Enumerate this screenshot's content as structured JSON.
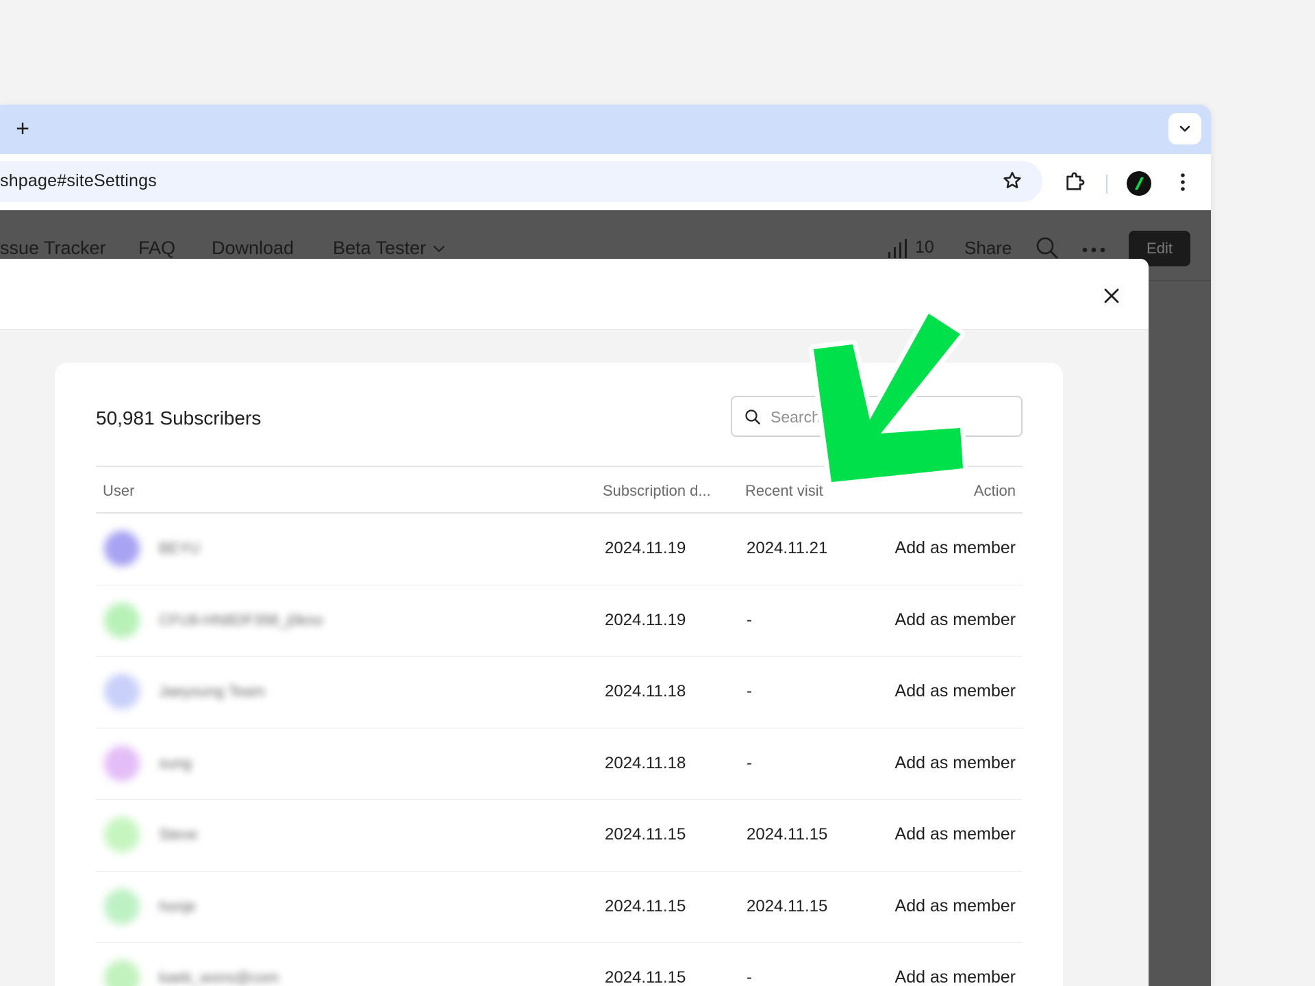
{
  "browser": {
    "new_tab_label": "+",
    "url": "shpage#siteSettings"
  },
  "nav": {
    "items": [
      "ssue Tracker",
      "FAQ",
      "Download",
      "Beta Tester"
    ],
    "stats_count": "10",
    "share_label": "Share",
    "edit_label": "Edit"
  },
  "subscribers": {
    "title": "50,981 Subscribers",
    "search_placeholder": "Search",
    "columns": {
      "user": "User",
      "subscription_date": "Subscription d...",
      "recent_visit": "Recent visit",
      "action": "Action"
    },
    "rows": [
      {
        "name": "BEYU",
        "subscribed": "2024.11.19",
        "recent": "2024.11.21",
        "action": "Add as member",
        "avatar_color": "#a8a3f3"
      },
      {
        "name": "CFU8-HN8DF398_j0kno",
        "subscribed": "2024.11.19",
        "recent": "-",
        "action": "Add as member",
        "avatar_color": "#b8f1b8"
      },
      {
        "name": "Jaeyoung Team",
        "subscribed": "2024.11.18",
        "recent": "-",
        "action": "Add as member",
        "avatar_color": "#c9d0fa"
      },
      {
        "name": "sung",
        "subscribed": "2024.11.18",
        "recent": "-",
        "action": "Add as member",
        "avatar_color": "#e3bdf7"
      },
      {
        "name": "Steve",
        "subscribed": "2024.11.15",
        "recent": "2024.11.15",
        "action": "Add as member",
        "avatar_color": "#c6f5c0"
      },
      {
        "name": "honje",
        "subscribed": "2024.11.15",
        "recent": "2024.11.15",
        "action": "Add as member",
        "avatar_color": "#bdf1c4"
      },
      {
        "name": "kaeb_wons@com",
        "subscribed": "2024.11.15",
        "recent": "-",
        "action": "Add as member",
        "avatar_color": "#c2f2bd"
      }
    ]
  },
  "colors": {
    "annotation_arrow": "#00e04b",
    "tabstrip": "#cfdefa",
    "edit_button": "#1b1b1b"
  }
}
